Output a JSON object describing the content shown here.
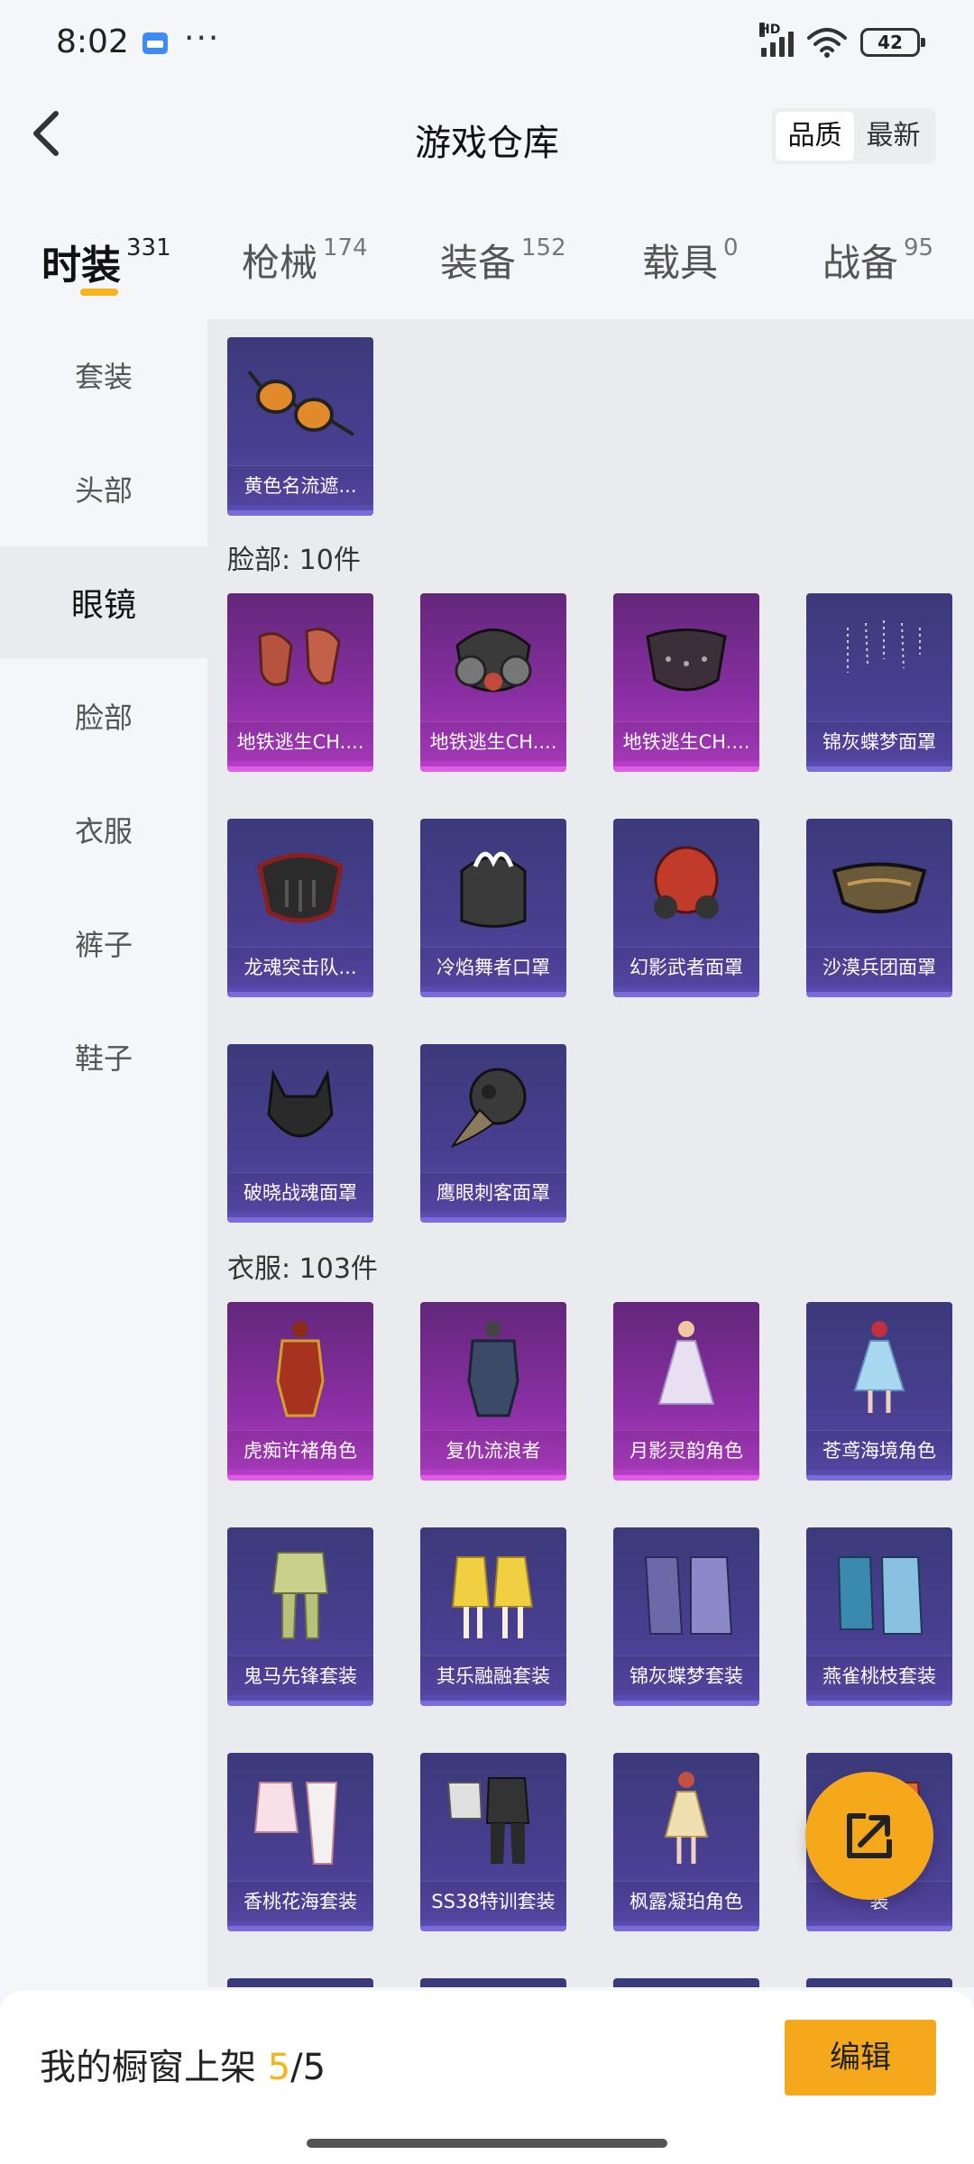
{
  "status": {
    "time": "8:02",
    "more": "···",
    "network_label": "HD",
    "battery": "42"
  },
  "header": {
    "title": "游戏仓库",
    "sort_options": [
      "品质",
      "最新"
    ],
    "active_sort": "品质"
  },
  "tabs": [
    {
      "label": "时装",
      "count": "331"
    },
    {
      "label": "枪械",
      "count": "174"
    },
    {
      "label": "装备",
      "count": "152"
    },
    {
      "label": "载具",
      "count": "0"
    },
    {
      "label": "战备",
      "count": "95"
    }
  ],
  "sidebar": [
    "套装",
    "头部",
    "眼镜",
    "脸部",
    "衣服",
    "裤子",
    "鞋子"
  ],
  "active_sidebar": "眼镜",
  "glasses_items": [
    {
      "name": "黄色名流遮...",
      "rarity": "purple",
      "icon": "glasses-icon"
    }
  ],
  "face_section": {
    "title": "脸部: 10件"
  },
  "face_items": [
    {
      "name": "地铁逃生CH....",
      "rarity": "pink",
      "icon": "face-cloth-icon"
    },
    {
      "name": "地铁逃生CH....",
      "rarity": "pink",
      "icon": "gas-mask-icon"
    },
    {
      "name": "地铁逃生CH....",
      "rarity": "pink",
      "icon": "spiked-mask-icon"
    },
    {
      "name": "锦灰蝶梦面罩",
      "rarity": "purple",
      "icon": "chain-veil-icon"
    },
    {
      "name": "龙魂突击队...",
      "rarity": "purple",
      "icon": "dragon-mask-icon"
    },
    {
      "name": "冷焰舞者口罩",
      "rarity": "purple",
      "icon": "flame-mask-icon"
    },
    {
      "name": "幻影武者面罩",
      "rarity": "purple",
      "icon": "warrior-mask-icon"
    },
    {
      "name": "沙漠兵团面罩",
      "rarity": "purple",
      "icon": "desert-mask-icon"
    },
    {
      "name": "破晓战魂面罩",
      "rarity": "purple",
      "icon": "wolf-mask-icon"
    },
    {
      "name": "鹰眼刺客面罩",
      "rarity": "purple",
      "icon": "plague-mask-icon"
    }
  ],
  "clothes_section": {
    "title": "衣服: 103件"
  },
  "clothes_items": [
    {
      "name": "虎痴许褚角色",
      "rarity": "pink",
      "icon": "armor-character-icon"
    },
    {
      "name": "复仇流浪者",
      "rarity": "pink",
      "icon": "mech-character-icon"
    },
    {
      "name": "月影灵韵角色",
      "rarity": "pink",
      "icon": "dress-character-icon"
    },
    {
      "name": "苍鸢海境角色",
      "rarity": "purple",
      "icon": "blue-dress-character-icon"
    },
    {
      "name": "鬼马先锋套装",
      "rarity": "purple",
      "icon": "green-outfit-icon"
    },
    {
      "name": "其乐融融套装",
      "rarity": "purple",
      "icon": "yellow-outfit-icon"
    },
    {
      "name": "锦灰蝶梦套装",
      "rarity": "purple",
      "icon": "robe-outfit-icon"
    },
    {
      "name": "燕雀桃枝套装",
      "rarity": "purple",
      "icon": "blue-robe-outfit-icon"
    },
    {
      "name": "香桃花海套装",
      "rarity": "purple",
      "icon": "pink-outfit-icon"
    },
    {
      "name": "SS38特训套装",
      "rarity": "purple",
      "icon": "training-outfit-icon"
    },
    {
      "name": "枫露凝珀角色",
      "rarity": "purple",
      "icon": "gold-dress-character-icon"
    },
    {
      "name": "装",
      "rarity": "purple",
      "icon": "orange-outfit-icon"
    }
  ],
  "bottom": {
    "label": "我的橱窗上架 ",
    "current": "5",
    "sep": "/",
    "total": "5",
    "edit": "编辑"
  },
  "colors": {
    "accent": "#f4a91c",
    "pink_rarity": "#b43ec8",
    "purple_rarity": "#5c4bb0"
  }
}
